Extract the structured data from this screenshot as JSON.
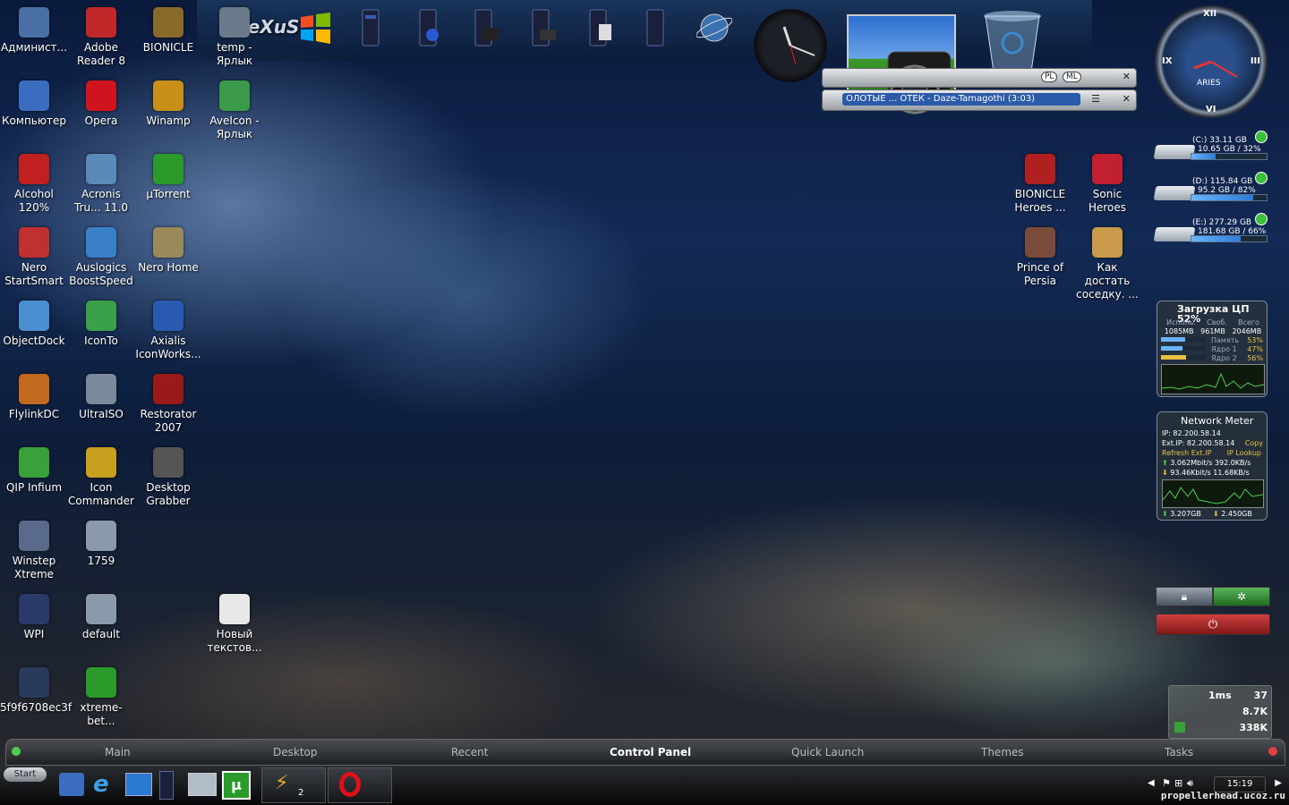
{
  "desktop_icons": [
    {
      "label": "Админист...",
      "icon": "user-icon",
      "color": "#4a6fa5"
    },
    {
      "label": "Adobe Reader 8",
      "icon": "pdf-icon",
      "color": "#c0282a"
    },
    {
      "label": "BIONICLE",
      "icon": "game-icon",
      "color": "#8a6a2a"
    },
    {
      "label": "temp - Ярлык",
      "icon": "folder-icon",
      "color": "#6a7a8a"
    },
    {
      "label": "Компьютер",
      "icon": "computer-icon",
      "color": "#3a6cc0"
    },
    {
      "label": "Opera",
      "icon": "opera-icon",
      "color": "#d0141e"
    },
    {
      "label": "Winamp",
      "icon": "winamp-icon",
      "color": "#c89018"
    },
    {
      "label": "AveIcon - Ярлык",
      "icon": "recycle-icon",
      "color": "#3a9a4a"
    },
    {
      "label": "Alcohol 120%",
      "icon": "alcohol-icon",
      "color": "#c02020"
    },
    {
      "label": "Acronis Tru... 11.0",
      "icon": "disk-icon",
      "color": "#5a8ab8"
    },
    {
      "label": "µTorrent",
      "icon": "utorrent-icon",
      "color": "#2a9a2a"
    },
    {
      "label": "Nero StartSmart",
      "icon": "nero-icon",
      "color": "#c03030"
    },
    {
      "label": "Auslogics BoostSpeed",
      "icon": "globe-icon",
      "color": "#3a80c8"
    },
    {
      "label": "Nero Home",
      "icon": "house-icon",
      "color": "#9a8a5a"
    },
    {
      "label": "ObjectDock",
      "icon": "dock-icon",
      "color": "#4a90d0"
    },
    {
      "label": "IconTo",
      "icon": "puzzle-icon",
      "color": "#3aa04a"
    },
    {
      "label": "Axialis IconWorks...",
      "icon": "axialis-icon",
      "color": "#2a5ab0"
    },
    {
      "label": "FlylinkDC",
      "icon": "flylink-icon",
      "color": "#c06a20"
    },
    {
      "label": "UltraISO",
      "icon": "cd-icon",
      "color": "#7a8a9a"
    },
    {
      "label": "Restorator 2007",
      "icon": "res-icon",
      "color": "#9a1a1a"
    },
    {
      "label": "QIP Infium",
      "icon": "qip-icon",
      "color": "#3aa03a"
    },
    {
      "label": "Icon Commander",
      "icon": "windows-icon",
      "color": "#c8a020"
    },
    {
      "label": "Desktop Grabber",
      "icon": "dna-icon",
      "color": "#555555"
    },
    {
      "label": "Winstep Xtreme",
      "icon": "winstep-icon",
      "color": "#5a6a8a"
    },
    {
      "label": "1759",
      "icon": "image-icon",
      "color": "#8a9aaa"
    },
    {
      "label": "WPI",
      "icon": "tower-icon",
      "color": "#2a3a6a"
    },
    {
      "label": "default",
      "icon": "image-icon",
      "color": "#8a9aaa"
    },
    {
      "label": "Новый текстов...",
      "icon": "text-file-icon",
      "color": "#e8e8e8"
    },
    {
      "label": "5f9f6708ec3f",
      "icon": "image-icon",
      "color": "#2a3a5a"
    },
    {
      "label": "xtreme-bet...",
      "icon": "utorrent-icon",
      "color": "#2a9a2a"
    },
    {
      "label": "BIONICLE Heroes ...",
      "icon": "game-icon",
      "color": "#b02020"
    },
    {
      "label": "Sonic Heroes",
      "icon": "sonic-icon",
      "color": "#c02030"
    },
    {
      "label": "Prince of Persia",
      "icon": "game-icon",
      "color": "#7a4a3a"
    },
    {
      "label": "Как достать соседку. ...",
      "icon": "game-icon",
      "color": "#c89a4a"
    }
  ],
  "dock": {
    "brand": "NeXuS",
    "items": [
      "windows-logo-icon",
      "tower-icon",
      "tower-icon",
      "tower-icon",
      "tower-icon",
      "tower-icon",
      "tower-icon",
      "globe-icon"
    ]
  },
  "player": {
    "track": "ОЛОТЫЕ ... ОТЕК - Daze-Tamagothi (3:03)",
    "btn_pl": "PL",
    "btn_ml": "ML"
  },
  "astro_clock": {
    "sign": "ARIES",
    "n": "XII",
    "e": "III",
    "s": "VI",
    "w": "IX"
  },
  "drives": [
    {
      "name": "(C:) 33.11 GB",
      "detail": "10.65 GB / 32%",
      "used": 0.32
    },
    {
      "name": "(D:) 115.84 GB",
      "detail": "95.2 GB / 82%",
      "used": 0.82
    },
    {
      "name": "(E:) 277.29 GB",
      "detail": "181.68 GB / 66%",
      "used": 0.66
    }
  ],
  "cpu": {
    "title": "Загрузка ЦП",
    "percent": "52%",
    "cols": [
      "Исполь.",
      "Своб.",
      "Всего"
    ],
    "vals": [
      "1085MB",
      "961MB",
      "2046MB"
    ],
    "rows": [
      {
        "label": "Память",
        "value": "53%",
        "level": 0.53
      },
      {
        "label": "Ядро 1",
        "value": "47%",
        "level": 0.47
      },
      {
        "label": "Ядро 2",
        "value": "56%",
        "level": 0.56
      }
    ]
  },
  "network": {
    "title": "Network Meter",
    "ip": "IP: 82.200.58.14",
    "ext_ip": "Ext.IP: 82.200.58.14",
    "copy": "Copy",
    "refresh": "Refresh Ext.IP",
    "lookup": "IP Lookup",
    "up": "3.062Mbit/s",
    "up_kb": "392.0KB/s",
    "down": "93.46Kbit/s",
    "down_kb": "11.68KB/s",
    "total_up": "3.207GB",
    "total_down": "2.450GB"
  },
  "ping": {
    "ms": "1ms",
    "count": "37",
    "v1": "8.7K",
    "v2": "338K"
  },
  "taskbar": {
    "tabs": [
      "Main",
      "Desktop",
      "Recent",
      "Control Panel",
      "Quick Launch",
      "Themes",
      "Tasks"
    ],
    "active": "Control Panel",
    "start": "Start",
    "task_count": "2",
    "time": "15:19",
    "watermark": "propellerhead.ucoz.ru"
  }
}
